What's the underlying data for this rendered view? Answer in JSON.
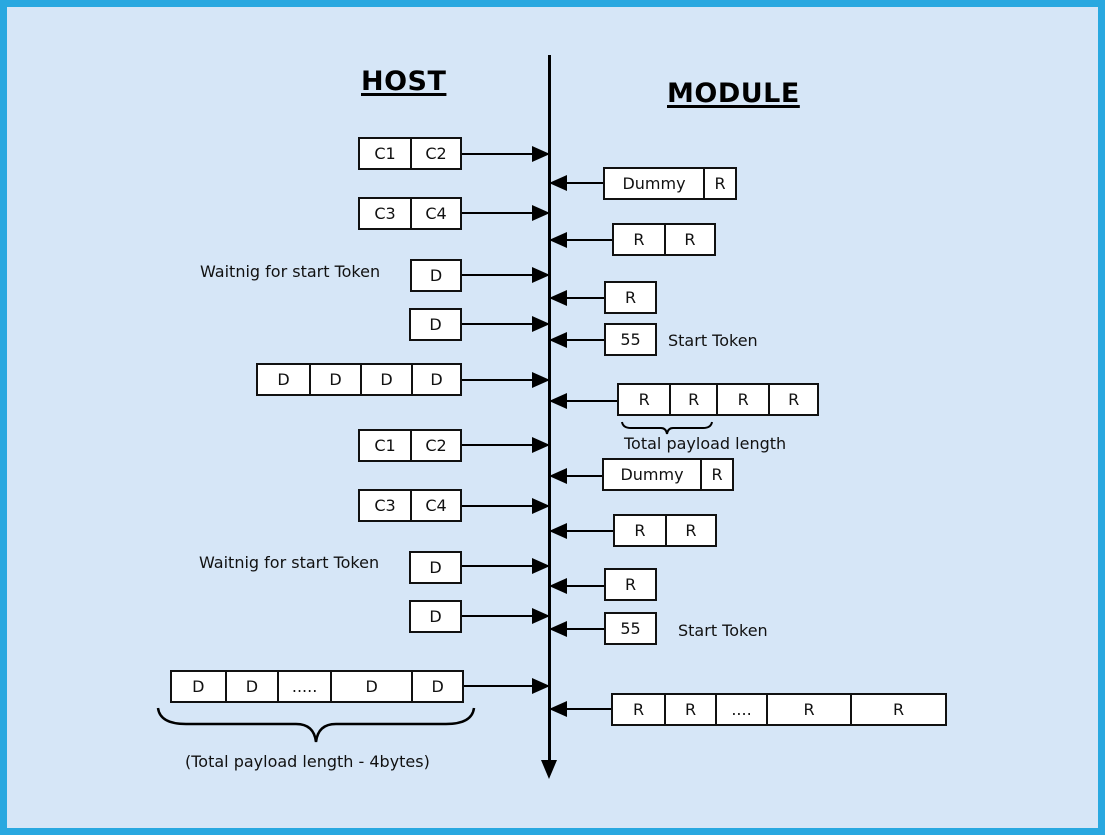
{
  "titles": {
    "host": "HOST",
    "module": "MODULE"
  },
  "colors": {
    "background": "#d6e6f7",
    "frame": "#29a8e0",
    "packet_fill": "#ffffff",
    "stroke": "#000000"
  },
  "host": {
    "packets": [
      {
        "cells": [
          "C1",
          "C2"
        ]
      },
      {
        "cells": [
          "C3",
          "C4"
        ]
      },
      {
        "cells": [
          "D"
        ],
        "note": "Waitnig for start Token"
      },
      {
        "cells": [
          "D"
        ]
      },
      {
        "cells": [
          "D",
          "D",
          "D",
          "D"
        ]
      },
      {
        "cells": [
          "C1",
          "C2"
        ]
      },
      {
        "cells": [
          "C3",
          "C4"
        ]
      },
      {
        "cells": [
          "D"
        ],
        "note": "Waitnig for start Token"
      },
      {
        "cells": [
          "D"
        ]
      },
      {
        "cells": [
          "D",
          "D",
          ".....",
          "D",
          "D"
        ],
        "brace_label": "(Total payload length - 4bytes)"
      }
    ]
  },
  "module": {
    "packets": [
      {
        "cells": [
          "Dummy",
          "R"
        ]
      },
      {
        "cells": [
          "R",
          "R"
        ]
      },
      {
        "cells": [
          "R"
        ]
      },
      {
        "cells": [
          "55"
        ],
        "note": "Start Token"
      },
      {
        "cells": [
          "R",
          "R",
          "R",
          "R"
        ],
        "brace_label": "Total payload length"
      },
      {
        "cells": [
          "Dummy",
          "R"
        ]
      },
      {
        "cells": [
          "R",
          "R"
        ]
      },
      {
        "cells": [
          "R"
        ]
      },
      {
        "cells": [
          "55"
        ],
        "note": "Start Token"
      },
      {
        "cells": [
          "R",
          "R",
          "....",
          "R",
          "R"
        ]
      }
    ]
  }
}
